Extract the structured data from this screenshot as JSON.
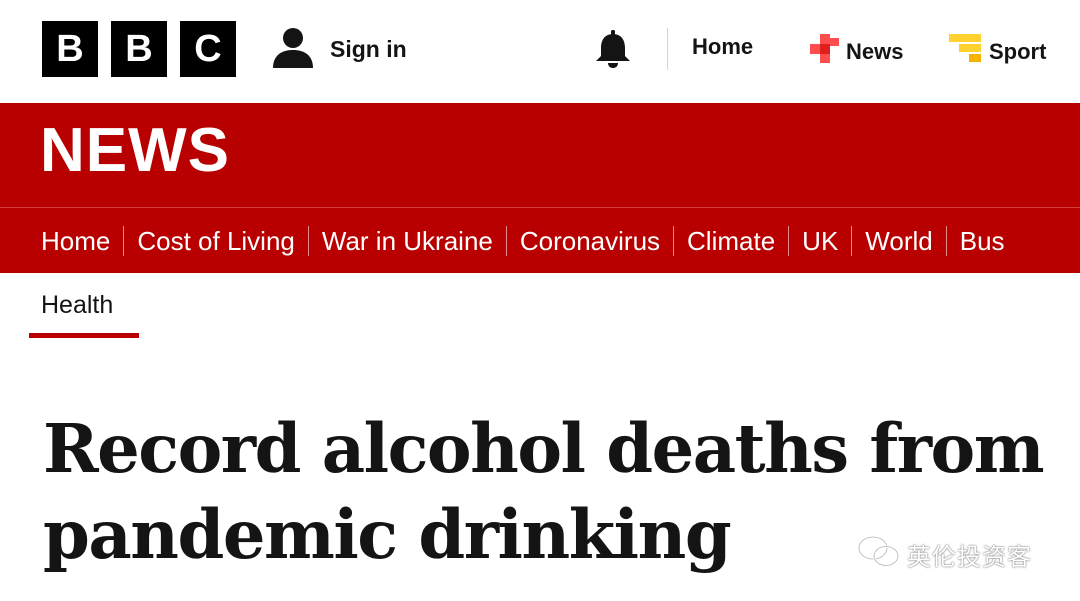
{
  "header": {
    "logo_letters": [
      "B",
      "B",
      "C"
    ],
    "sign_in_label": "Sign in",
    "nav": [
      {
        "label": "Home",
        "icon": "none"
      },
      {
        "label": "News",
        "icon": "news-icon"
      },
      {
        "label": "Sport",
        "icon": "sport-icon"
      }
    ],
    "colors": {
      "brand_black": "#000000",
      "news_icon_red": "#ff4c4c",
      "sport_icon_yellow": "#ffd230"
    }
  },
  "news_banner": {
    "title": "NEWS",
    "background_color": "#b80000",
    "nav_items": [
      "Home",
      "Cost of Living",
      "War in Ukraine",
      "Coronavirus",
      "Climate",
      "UK",
      "World",
      "Bus"
    ]
  },
  "section": {
    "label": "Health",
    "accent_color": "#b80000"
  },
  "article": {
    "headline_line1": "Record alcohol deaths from",
    "headline_line2": "pandemic drinking"
  },
  "watermark": {
    "text": "英伦投资客",
    "icon": "wechat-icon"
  }
}
